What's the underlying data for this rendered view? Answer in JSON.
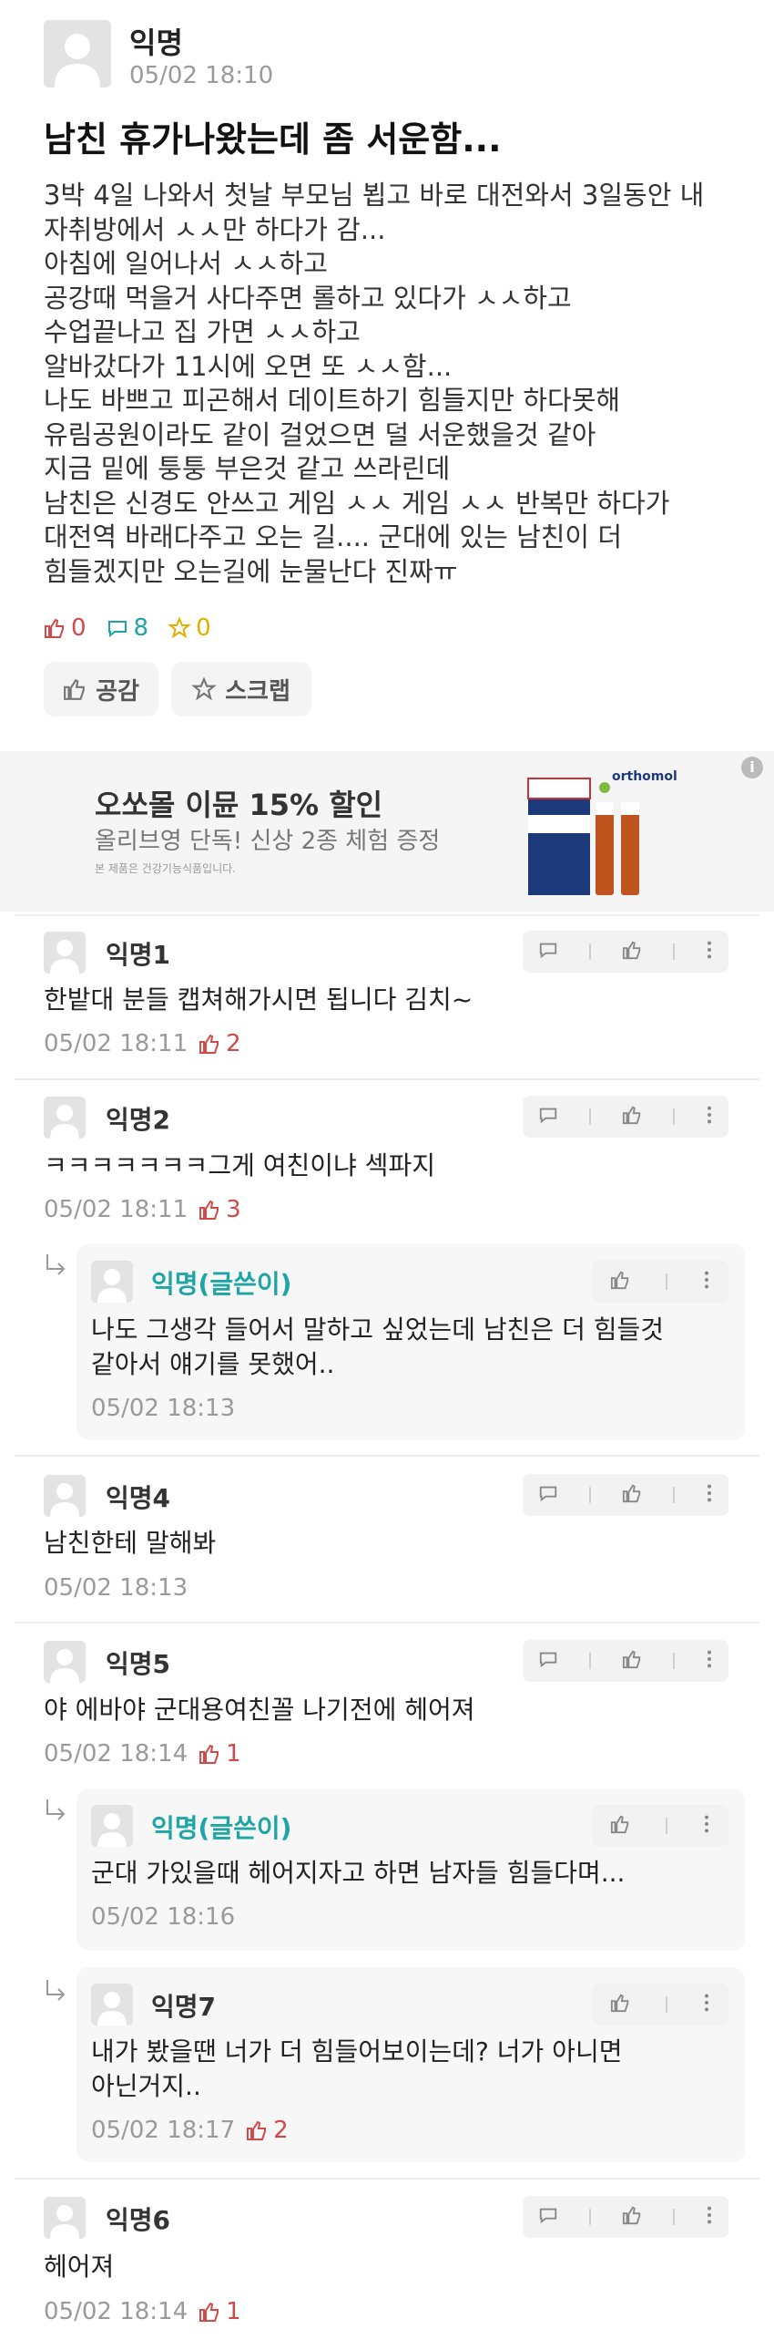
{
  "post": {
    "author": "익명",
    "time": "05/02 18:10",
    "title": "남친 휴가나왔는데 좀 서운함...",
    "body": [
      "3박 4일 나와서 첫날 부모님 뵙고 바로 대전와서 3일동안 내",
      "자취방에서 ㅅㅅ만 하다가 감...",
      "아침에 일어나서 ㅅㅅ하고",
      "공강때 먹을거 사다주면 롤하고 있다가 ㅅㅅ하고",
      "수업끝나고 집 가면 ㅅㅅ하고",
      "알바갔다가 11시에 오면 또 ㅅㅅ함...",
      "나도 바쁘고 피곤해서 데이트하기 힘들지만 하다못해",
      "유림공원이라도 같이 걸었으면 덜 서운했을것 같아",
      "지금 밑에 퉁퉁 부은것 같고 쓰라린데",
      "남친은 신경도 안쓰고 게임 ㅅㅅ 게임 ㅅㅅ 반복만 하다가",
      "대전역 바래다주고 오는 길.... 군대에 있는 남친이 더",
      "힘들겠지만 오는길에 눈물난다 진짜ㅠ"
    ],
    "likes": "0",
    "comments": "8",
    "scraps": "0",
    "like_button": "공감",
    "scrap_button": "스크랩"
  },
  "ad": {
    "title": "오쏘몰 이뮨 15% 할인",
    "subtitle": "올리브영 단독! 신상 2종 체험 증정",
    "note": "본 제품은 건강기능식품입니다.",
    "brand": "orthomol"
  },
  "comments": [
    {
      "name": "익명1",
      "text": [
        "한밭대 분들 캡쳐해가시면 됩니다 김치~"
      ],
      "time": "05/02 18:11",
      "likes": "2"
    },
    {
      "name": "익명2",
      "text": [
        "ㅋㅋㅋㅋㅋㅋㅋ그게 여친이냐 섹파지"
      ],
      "time": "05/02 18:11",
      "likes": "3"
    },
    {
      "name": "익명(글쓴이)",
      "text": [
        "나도 그생각 들어서 말하고 싶었는데 남친은 더 힘들것",
        "같아서 얘기를 못했어.."
      ],
      "time": "05/02 18:13",
      "likes": ""
    },
    {
      "name": "익명4",
      "text": [
        "남친한테 말해봐"
      ],
      "time": "05/02 18:13",
      "likes": ""
    },
    {
      "name": "익명5",
      "text": [
        "야 에바야 군대용여친꼴 나기전에 헤어져"
      ],
      "time": "05/02 18:14",
      "likes": "1"
    },
    {
      "name": "익명(글쓴이)",
      "text": [
        "군대 가있을때 헤어지자고 하면 남자들 힘들다며..."
      ],
      "time": "05/02 18:16",
      "likes": ""
    },
    {
      "name": "익명7",
      "text": [
        "내가 봤을땐 너가 더 힘들어보이는데? 너가 아니면",
        "아닌거지.."
      ],
      "time": "05/02 18:17",
      "likes": "2"
    },
    {
      "name": "익명6",
      "text": [
        "헤어져"
      ],
      "time": "05/02 18:14",
      "likes": "1"
    }
  ],
  "colors": {
    "like_red": "#d14a4a",
    "comment_teal": "#1fa5a5",
    "scrap_yellow": "#e0b000",
    "op_name": "#1fa5a5"
  }
}
